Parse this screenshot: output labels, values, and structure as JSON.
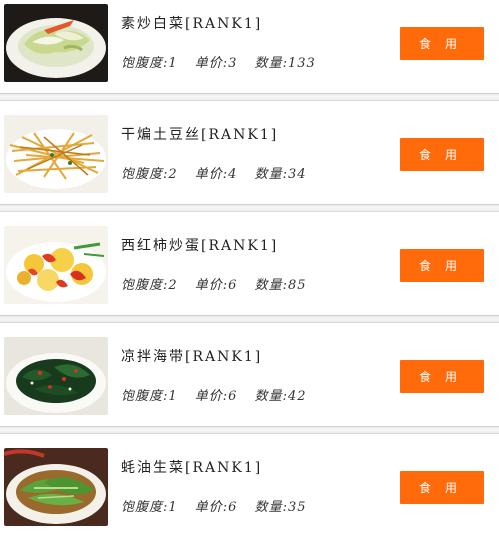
{
  "dishes": [
    {
      "name": "素炒白菜[RANK1]",
      "satiety": "饱腹度:1",
      "price": "单价:3",
      "quantity": "数量:133",
      "action_label": "食用",
      "image": "stir-fried-cabbage"
    },
    {
      "name": "干煸土豆丝[RANK1]",
      "satiety": "饱腹度:2",
      "price": "单价:4",
      "quantity": "数量:34",
      "action_label": "食用",
      "image": "shredded-potato"
    },
    {
      "name": "西红柿炒蛋[RANK1]",
      "satiety": "饱腹度:2",
      "price": "单价:6",
      "quantity": "数量:85",
      "action_label": "食用",
      "image": "tomato-egg"
    },
    {
      "name": "凉拌海带[RANK1]",
      "satiety": "饱腹度:1",
      "price": "单价:6",
      "quantity": "数量:42",
      "action_label": "食用",
      "image": "seaweed-salad"
    },
    {
      "name": "蚝油生菜[RANK1]",
      "satiety": "饱腹度:1",
      "price": "单价:6",
      "quantity": "数量:35",
      "action_label": "食用",
      "image": "oyster-sauce-lettuce"
    }
  ],
  "colors": {
    "button": "#ff6a0a",
    "button_text": "#ffffff"
  }
}
